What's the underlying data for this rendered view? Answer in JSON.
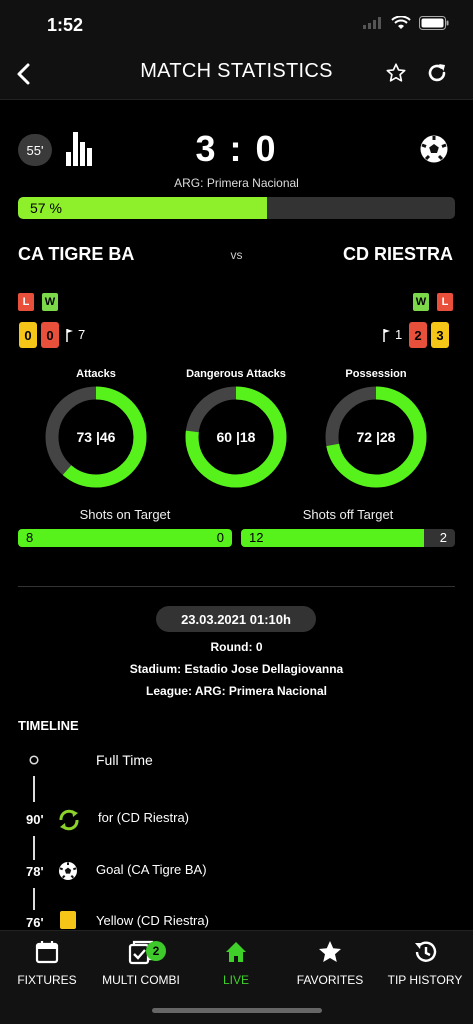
{
  "status_bar": {
    "time": "1:52"
  },
  "header": {
    "title": "MATCH STATISTICS"
  },
  "match": {
    "minute": "55'",
    "score": "3 : 0",
    "league": "ARG: Primera Nacional",
    "progress_label": "57 %",
    "progress_value": 0.57,
    "home_team": "CA TIGRE BA",
    "vs": "vs",
    "away_team": "CD RIESTRA"
  },
  "home_form": {
    "chips": [
      "L",
      "W"
    ],
    "yellow": "0",
    "red": "0",
    "corners": "7"
  },
  "away_form": {
    "chips": [
      "W",
      "L"
    ],
    "yellow": "3",
    "red": "2",
    "corners": "1"
  },
  "stats": {
    "donuts": [
      {
        "title": "Attacks",
        "home": 73,
        "away": 46,
        "label": "73 |46"
      },
      {
        "title": "Dangerous Attacks",
        "home": 60,
        "away": 18,
        "label": "60 |18"
      },
      {
        "title": "Possession",
        "home": 72,
        "away": 28,
        "label": "72 |28"
      }
    ],
    "shots_on": {
      "title": "Shots on Target",
      "home": "8",
      "away": "0",
      "home_value": 8,
      "away_value": 0
    },
    "shots_off": {
      "title": "Shots off Target",
      "home": "12",
      "away": "2",
      "home_value": 12,
      "away_value": 2
    }
  },
  "details": {
    "datetime": "23.03.2021 01:10h",
    "round_label": "Round:",
    "round": "0",
    "stadium_label": "Stadium:",
    "stadium": "Estadio Jose Dellagiovanna",
    "league_label": "League:",
    "league": "ARG: Primera Nacional"
  },
  "timeline": {
    "title": "TIMELINE",
    "events": [
      {
        "minute": "",
        "text": "Full Time",
        "icon": "circle-icon"
      },
      {
        "minute": "90'",
        "text": "for  (CD Riestra)",
        "icon": "substitution-icon"
      },
      {
        "minute": "78'",
        "text": "Goal (CA Tigre BA)",
        "icon": "ball-icon"
      },
      {
        "minute": "76'",
        "text": "Yellow (CD Riestra)",
        "icon": "yellow-card-icon"
      }
    ]
  },
  "tabs": [
    {
      "label": "FIXTURES",
      "icon": "calendar-icon"
    },
    {
      "label": "MULTI COMBI",
      "icon": "checklist-icon",
      "badge": "2"
    },
    {
      "label": "LIVE",
      "icon": "home-icon",
      "active": true
    },
    {
      "label": "FAVORITES",
      "icon": "star-icon"
    },
    {
      "label": "TIP HISTORY",
      "icon": "history-icon"
    }
  ],
  "colors": {
    "accent": "#57f21b",
    "progress": "#8ef02b",
    "lost": "#e8503c",
    "won": "#7cd94a",
    "yellow": "#f5c518",
    "track": "#444444"
  }
}
